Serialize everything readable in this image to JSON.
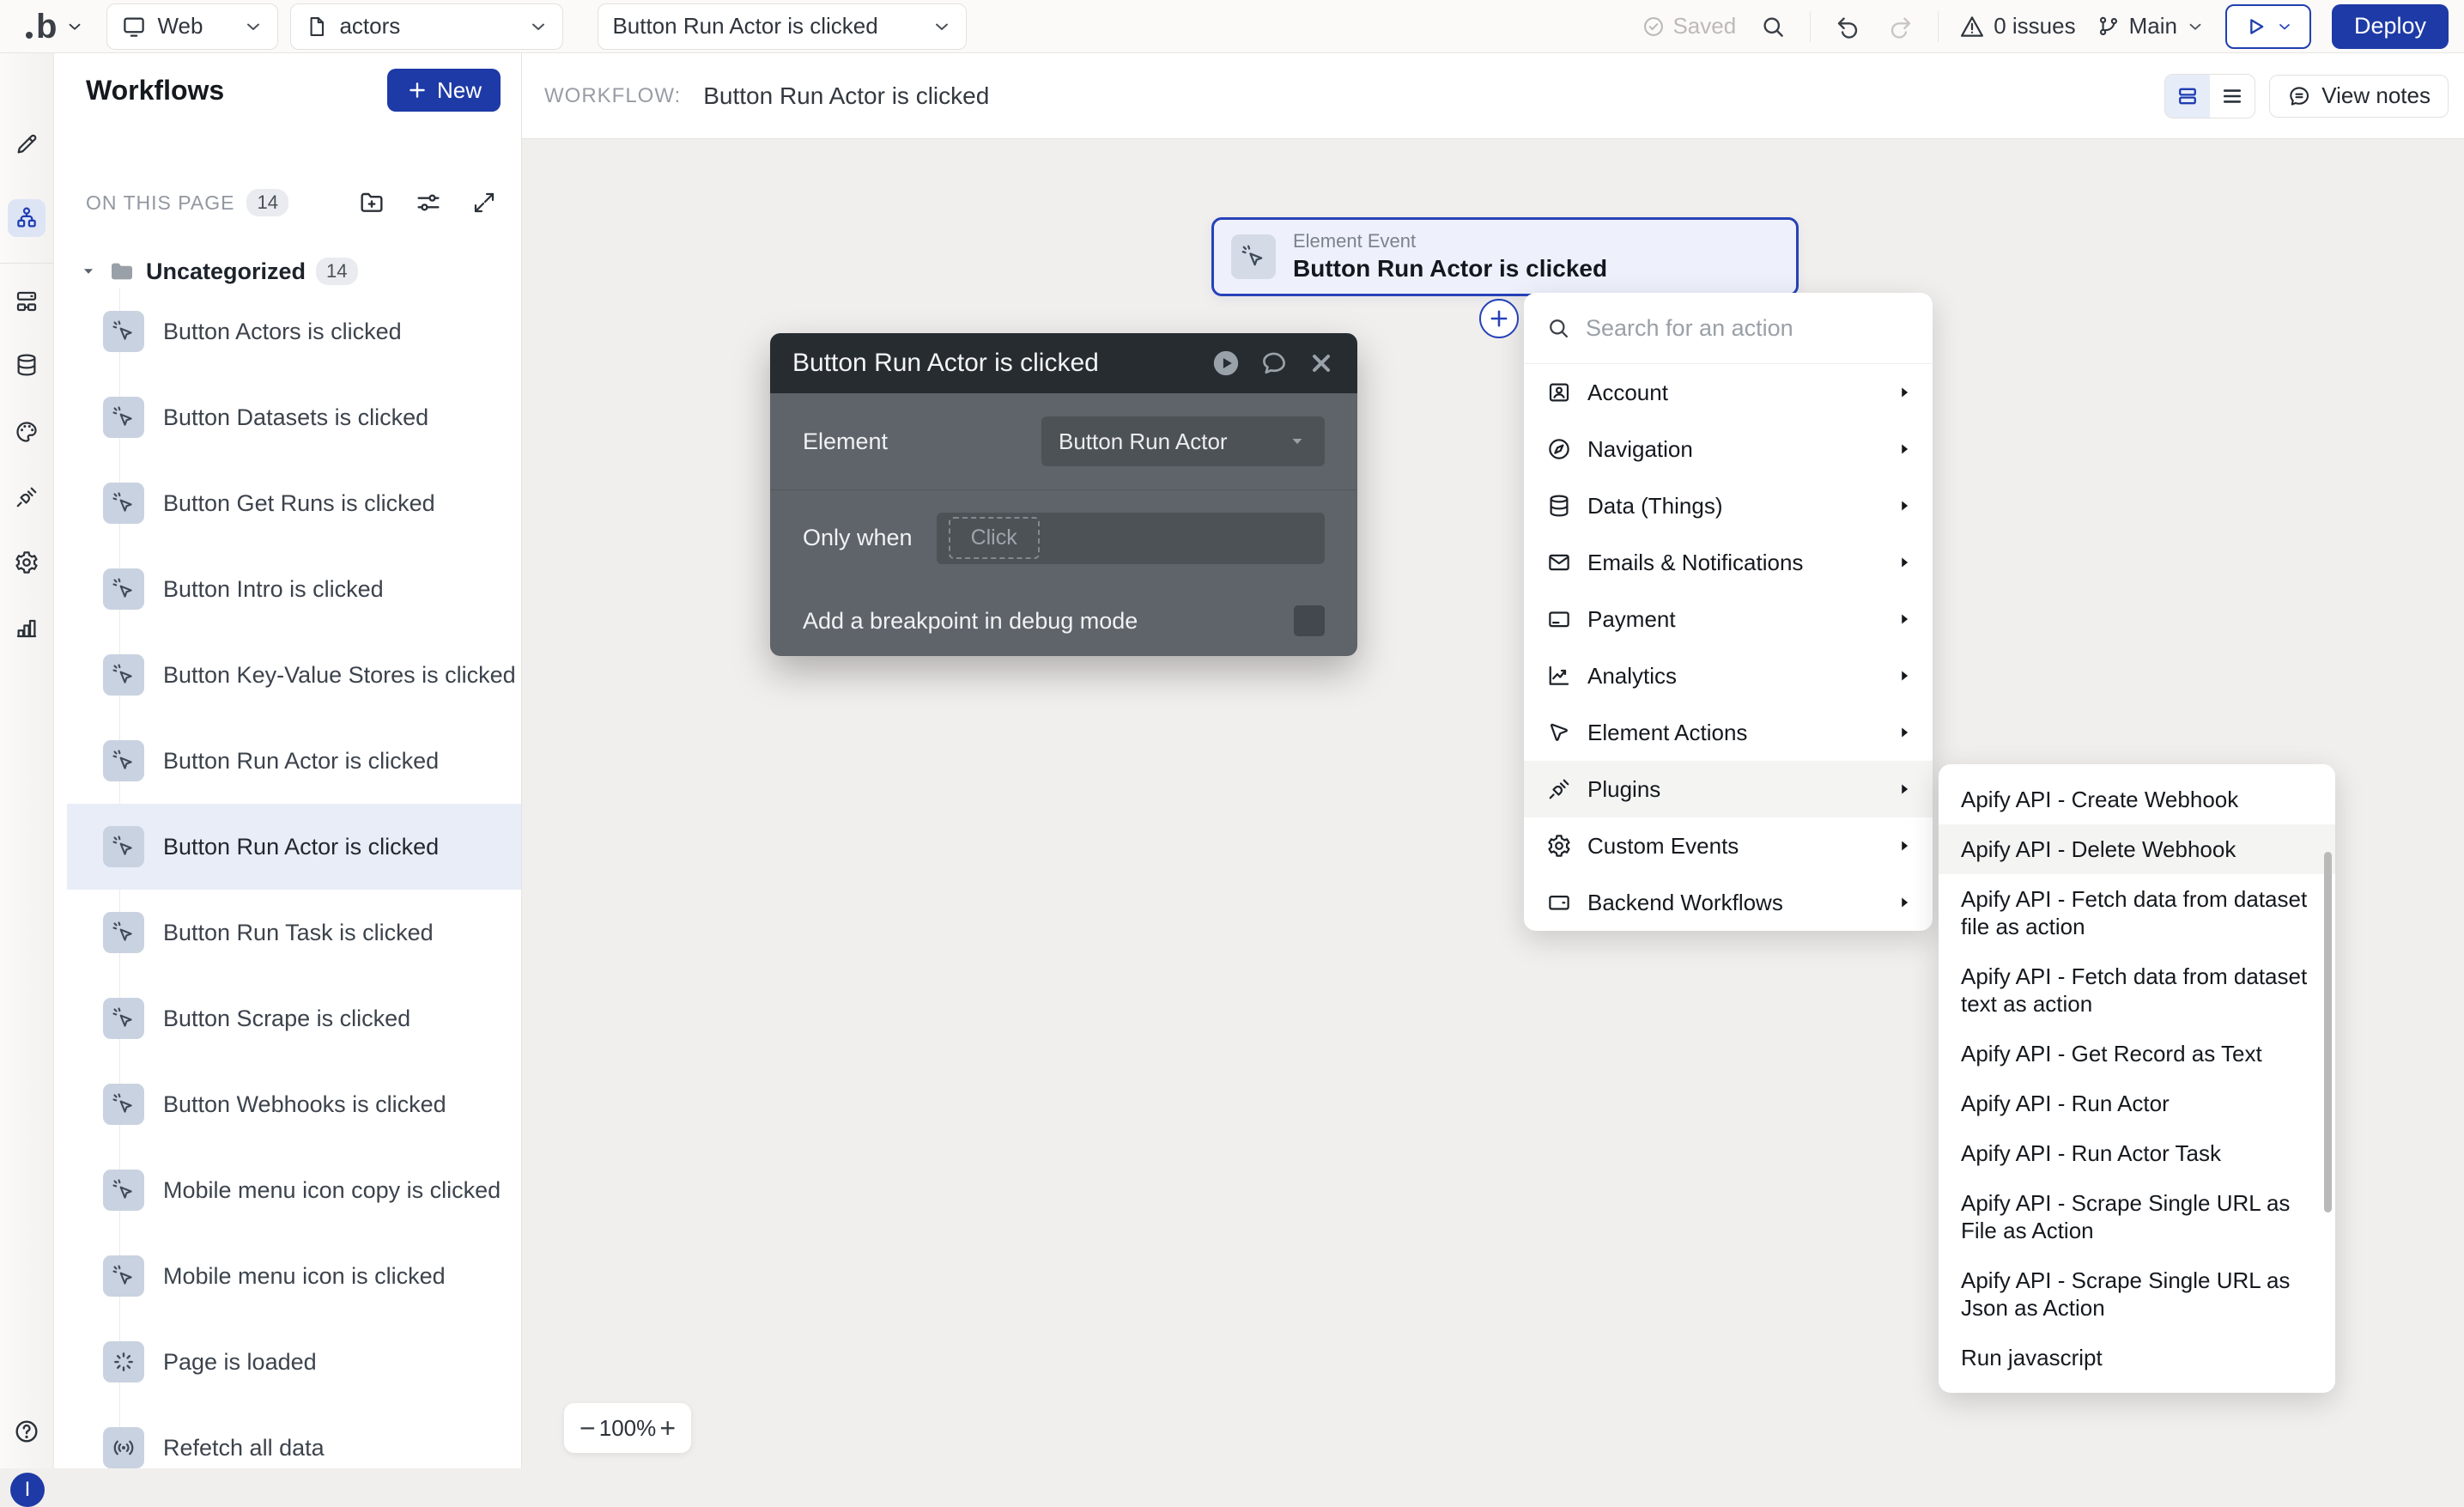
{
  "colors": {
    "accent": "#1e3aa6",
    "node_border": "#2742b8",
    "selected_row": "#e8edf8",
    "dialog_header": "#272c31",
    "dialog_body": "#5f646a"
  },
  "topbar": {
    "logo": "b",
    "platform": {
      "label": "Web",
      "icon": "monitor-icon"
    },
    "page": {
      "label": "actors",
      "icon": "file-icon"
    },
    "workflow_select": {
      "label": "Button Run Actor is clicked"
    },
    "saved_label": "Saved",
    "issues_label": "0 issues",
    "branch_label": "Main",
    "deploy_label": "Deploy"
  },
  "rail": {
    "items": [
      {
        "icon": "i-pencil",
        "name": "design"
      },
      {
        "icon": "i-tree",
        "name": "workflows",
        "selected": true
      },
      {
        "icon": "i-layers",
        "name": "components"
      },
      {
        "icon": "i-database",
        "name": "data"
      },
      {
        "icon": "i-palette",
        "name": "styles"
      },
      {
        "icon": "i-plug",
        "name": "plugins"
      },
      {
        "icon": "i-gear",
        "name": "settings"
      },
      {
        "icon": "i-bars",
        "name": "logs"
      }
    ],
    "help_name": "help",
    "avatar_initial": "I"
  },
  "workflows_panel": {
    "title": "Workflows",
    "new_label": "New",
    "on_this_page_label": "ON THIS PAGE",
    "page_count": "14",
    "folder": {
      "name": "Uncategorized",
      "count": "14"
    },
    "items": [
      {
        "label": "Button Actors is clicked",
        "icon": "i-cursor-click"
      },
      {
        "label": "Button Datasets is clicked",
        "icon": "i-cursor-click"
      },
      {
        "label": "Button Get Runs is clicked",
        "icon": "i-cursor-click"
      },
      {
        "label": "Button Intro is clicked",
        "icon": "i-cursor-click"
      },
      {
        "label": "Button Key-Value Stores is clicked",
        "icon": "i-cursor-click"
      },
      {
        "label": "Button Run Actor is clicked",
        "icon": "i-cursor-click"
      },
      {
        "label": "Button Run Actor is clicked",
        "icon": "i-cursor-click",
        "selected": true
      },
      {
        "label": "Button Run Task is clicked",
        "icon": "i-cursor-click"
      },
      {
        "label": "Button Scrape is clicked",
        "icon": "i-cursor-click"
      },
      {
        "label": "Button Webhooks is clicked",
        "icon": "i-cursor-click"
      },
      {
        "label": "Mobile menu icon copy is clicked",
        "icon": "i-cursor-click"
      },
      {
        "label": "Mobile menu icon is clicked",
        "icon": "i-cursor-click"
      },
      {
        "label": "Page is loaded",
        "icon": "i-spinner"
      },
      {
        "label": "Refetch all data",
        "icon": "i-broadcast"
      }
    ]
  },
  "canvas": {
    "header_label": "WORKFLOW:",
    "header_title": "Button Run Actor is clicked",
    "view_notes_label": "View notes",
    "node": {
      "type": "Element Event",
      "title": "Button Run Actor is clicked"
    },
    "zoom": {
      "minus": "−",
      "level": "100%",
      "plus": "+"
    }
  },
  "dialog": {
    "title": "Button Run Actor is clicked",
    "element_label": "Element",
    "element_value": "Button Run Actor",
    "only_when_label": "Only when",
    "only_when_placeholder": "Click",
    "breakpoint_label": "Add a breakpoint in debug mode"
  },
  "action_menu": {
    "search_placeholder": "Search for an action",
    "categories": [
      {
        "label": "Account",
        "icon": "i-account"
      },
      {
        "label": "Navigation",
        "icon": "i-compass"
      },
      {
        "label": "Data (Things)",
        "icon": "i-database"
      },
      {
        "label": "Emails & Notifications",
        "icon": "i-mail"
      },
      {
        "label": "Payment",
        "icon": "i-card"
      },
      {
        "label": "Analytics",
        "icon": "i-chart"
      },
      {
        "label": "Element Actions",
        "icon": "i-cursor"
      },
      {
        "label": "Plugins",
        "icon": "i-plug",
        "highlighted": true
      },
      {
        "label": "Custom Events",
        "icon": "i-gear"
      },
      {
        "label": "Backend Workflows",
        "icon": "i-window"
      }
    ]
  },
  "submenu": {
    "items": [
      {
        "label": "Apify API - Create Webhook"
      },
      {
        "label": "Apify API - Delete Webhook",
        "highlighted": true
      },
      {
        "label": "Apify API - Fetch data from dataset file as action"
      },
      {
        "label": "Apify API - Fetch data from dataset text as action"
      },
      {
        "label": "Apify API - Get Record as Text"
      },
      {
        "label": "Apify API - Run Actor"
      },
      {
        "label": "Apify API - Run Actor Task"
      },
      {
        "label": "Apify API - Scrape Single URL as File as Action"
      },
      {
        "label": "Apify API - Scrape Single URL as Json as Action"
      },
      {
        "label": "Run javascript"
      }
    ]
  }
}
